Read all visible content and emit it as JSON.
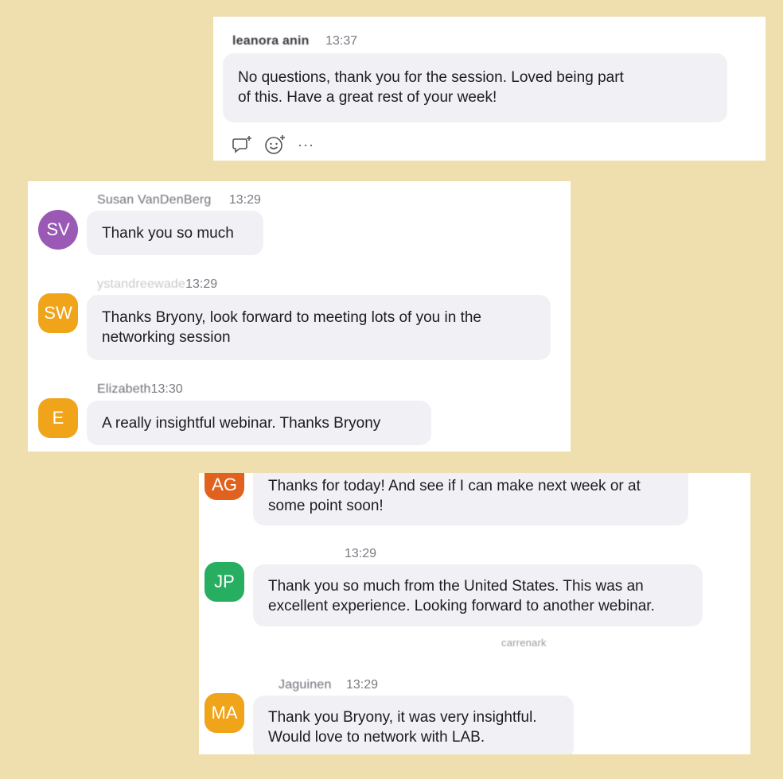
{
  "panel1": {
    "sender": "leanora anin",
    "time": "13:37",
    "lines": [
      "No questions, thank you for the session. Loved being part",
      "of this. Have a great rest of your week!"
    ],
    "reactions": [
      "reply-icon",
      "emoji-icon",
      "more-icon"
    ],
    "more_label": "···"
  },
  "panel2": {
    "messages": [
      {
        "initials": "SV",
        "color": "#9b59b6",
        "sender": "Susan VanDenBerg",
        "time": "13:29",
        "lines": [
          "Thank you so much"
        ]
      },
      {
        "initials": "SW",
        "color": "#f0a41a",
        "sender": "ystandreewade",
        "time": "13:29",
        "lines": [
          "Thanks Bryony, look forward to meeting lots of you in the",
          "networking session"
        ]
      },
      {
        "initials": "E",
        "color": "#f0a41a",
        "sender": "Elizabeth",
        "time": "13:30",
        "lines": [
          "A really insightful webinar. Thanks Bryony"
        ]
      }
    ]
  },
  "panel3": {
    "messages": [
      {
        "initials": "AG",
        "color": "#e0621e",
        "sender": "",
        "time": "",
        "lines": [
          "Thanks for today! And see if I can make next week or at",
          "some point soon!"
        ]
      },
      {
        "initials": "JP",
        "color": "#27ae60",
        "sender": "",
        "time": "13:29",
        "lines": [
          "Thank you so much from the United States. This was an",
          "excellent experience. Looking forward to another webinar."
        ]
      },
      {
        "initials": "",
        "color": "",
        "sender": "carrenark",
        "time": "",
        "lines": []
      },
      {
        "initials": "MA",
        "color": "#f0a41a",
        "sender": "Jaguinen",
        "time": "13:29",
        "lines": [
          "Thank you Bryony, it was very insightful.",
          "Would love to network with LAB."
        ]
      }
    ]
  }
}
